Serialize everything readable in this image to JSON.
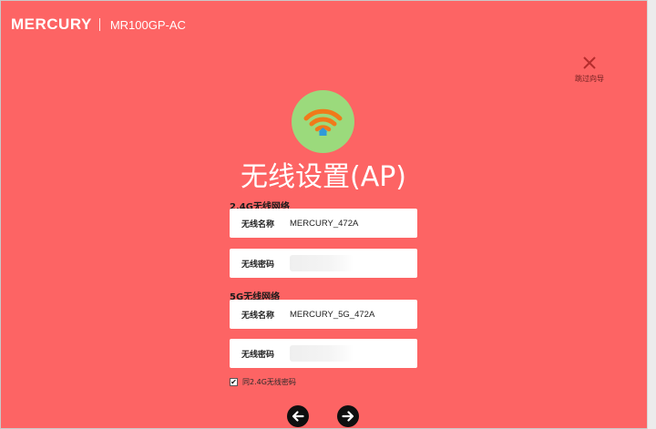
{
  "header": {
    "brand": "MERCURY",
    "model": "MR100GP-AC"
  },
  "skip": {
    "label": "跳过向导",
    "icon": "close-icon"
  },
  "hero": {
    "icon": "wifi-home-icon",
    "title": "无线设置(AP)"
  },
  "band_24": {
    "section_label": "2.4G无线网络",
    "ssid_label": "无线名称",
    "ssid_value": "MERCURY_472A",
    "password_label": "无线密码"
  },
  "band_5": {
    "section_label": "5G无线网络",
    "ssid_label": "无线名称",
    "ssid_value": "MERCURY_5G_472A",
    "password_label": "无线密码"
  },
  "same_password": {
    "checked": true,
    "mark": "✔",
    "label": "同2.4G无线密码"
  },
  "nav": {
    "back_icon": "arrow-left-icon",
    "next_icon": "arrow-right-icon"
  },
  "colors": {
    "background": "#fd6464",
    "icon_circle": "#9bda7c",
    "wifi_arcs": "#f07a1a",
    "wifi_house": "#2f9ad9"
  }
}
